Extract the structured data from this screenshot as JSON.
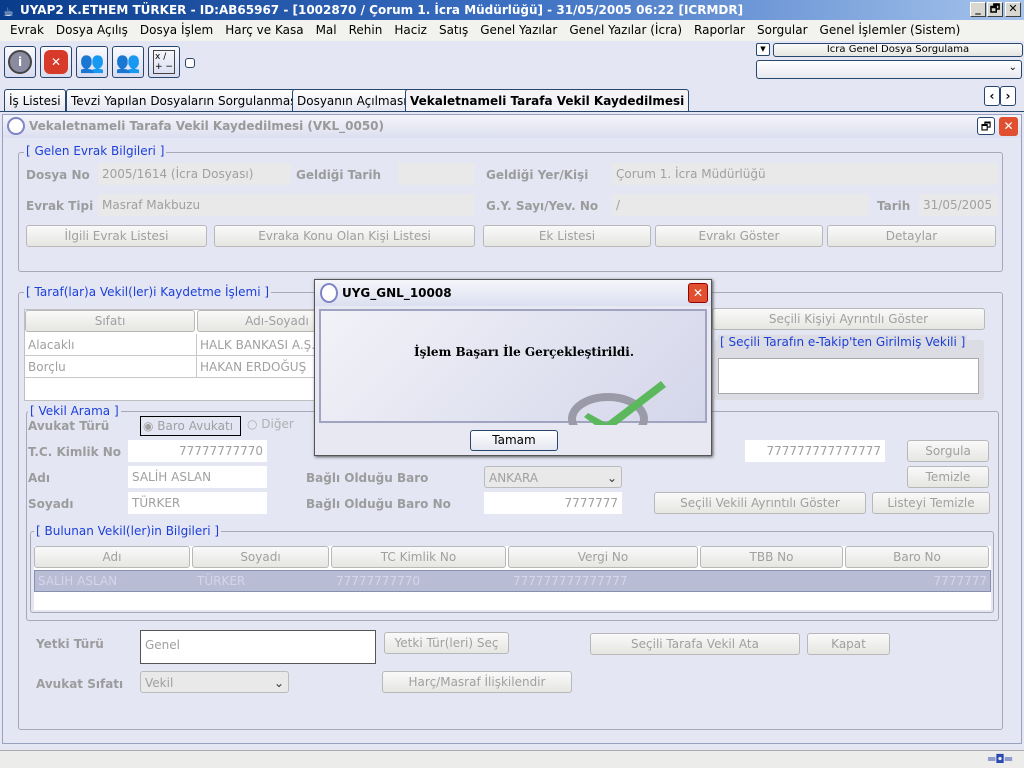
{
  "window": {
    "title": "UYAP2   K.ETHEM TÜRKER - ID:AB65967 - [1002870 / Çorum 1. İcra Müdürlüğü] - 31/05/2005 06:22 [ICRMDR]",
    "min": "_",
    "max": "🗗",
    "close": "✕"
  },
  "menu": [
    "Evrak",
    "Dosya Açılış",
    "Dosya İşlem",
    "Harç ve Kasa",
    "Mal",
    "Rehin",
    "Haciz",
    "Satış",
    "Genel Yazılar",
    "Genel Yazılar (İcra)",
    "Raporlar",
    "Sorgular",
    "Genel İşlemler (Sistem)"
  ],
  "quick": {
    "label": "İcra Genel Dosya Sorgulama",
    "dropdown": ""
  },
  "tabs": [
    "İş Listesi",
    "Tevzi Yapılan Dosyaların Sorgulanması",
    "Dosyanın Açılması",
    "Vekaletnameli Tarafa Vekil Kaydedilmesi"
  ],
  "frame": {
    "title": "Vekaletnameli Tarafa Vekil Kaydedilmesi (VKL_0050)"
  },
  "gelen": {
    "legend": "[ Gelen Evrak Bilgileri ]",
    "dosya_no_label": "Dosya No",
    "dosya_no": "2005/1614 (İcra Dosyası)",
    "geldigi_tarih_label": "Geldiği Tarih",
    "geldigi_tarih": "",
    "yer_label": "Geldiği Yer/Kişi",
    "yer": "Çorum 1. İcra Müdürlüğü",
    "evrak_tipi_label": "Evrak Tipi",
    "evrak_tipi": "Masraf Makbuzu",
    "gy_label": "G.Y. Sayı/Yev. No",
    "gy": "/",
    "tarih_label": "Tarih",
    "tarih": "31/05/2005",
    "buttons": [
      "İlgili Evrak Listesi",
      "Evraka Konu Olan Kişi Listesi",
      "Ek Listesi",
      "Evrakı Göster",
      "Detaylar"
    ]
  },
  "taraf": {
    "legend": "[ Taraf(lar)a Vekil(ler)i Kaydetme İşlemi ]",
    "headers": [
      "Sıfatı",
      "Adı-Soyadı"
    ],
    "rows": [
      [
        "Alacaklı",
        "HALK BANKASI A.Ş."
      ],
      [
        "Borçlu",
        "HAKAN ERDOĞUŞ"
      ]
    ],
    "detail_button": "Seçili Kişiyi Ayrıntılı Göster",
    "etakip_legend": "[ Seçili Tarafın e-Takip'ten Girilmiş Vekili ]",
    "etakip_value": ""
  },
  "arama": {
    "legend": "[ Vekil Arama ]",
    "avukat_turu_label": "Avukat Türü",
    "radio_baro": "Baro Avukatı",
    "radio_diger": "Diğer",
    "tc_label": "T.C. Kimlik No",
    "tc": "77777777770",
    "adi_label": "Adı",
    "adi": "SALİH ASLAN",
    "soyadi_label": "Soyadı",
    "soyadi": "TÜRKER",
    "baro_label": "Bağlı Olduğu Baro",
    "baro": "ANKARA",
    "baro_no_label": "Bağlı Olduğu Baro No",
    "baro_no": "7777777",
    "vergi": "777777777777777",
    "sorgula": "Sorgula",
    "temizle": "Temizle",
    "detail_button": "Seçili Vekili Ayrıntılı Göster",
    "listeyi_temizle": "Listeyi Temizle"
  },
  "bulunan": {
    "legend": "[ Bulunan Vekil(ler)in Bilgileri ]",
    "headers": [
      "Adı",
      "Soyadı",
      "TC Kimlik No",
      "Vergi No",
      "TBB No",
      "Baro No"
    ],
    "rows": [
      [
        "SALİH ASLAN",
        "TÜRKER",
        "77777777770",
        "777777777777777",
        "",
        "7777777"
      ]
    ]
  },
  "bottom": {
    "yetki_label": "Yetki Türü",
    "yetki": "Genel",
    "yetki_sec": "Yetki Tür(leri) Seç",
    "ata": "Seçili Tarafa Vekil Ata",
    "kapat": "Kapat",
    "sifat_label": "Avukat Sıfatı",
    "sifat": "Vekil",
    "harc": "Harç/Masraf İlişkilendir"
  },
  "dialog": {
    "title": "UYG_GNL_10008",
    "message": "İşlem Başarı İle Gerçekleştirildi.",
    "ok": "Tamam"
  },
  "colors": {
    "title_bar": "#0a3c8c",
    "legend": "#1c3fd8",
    "check": "#5cb85c"
  }
}
